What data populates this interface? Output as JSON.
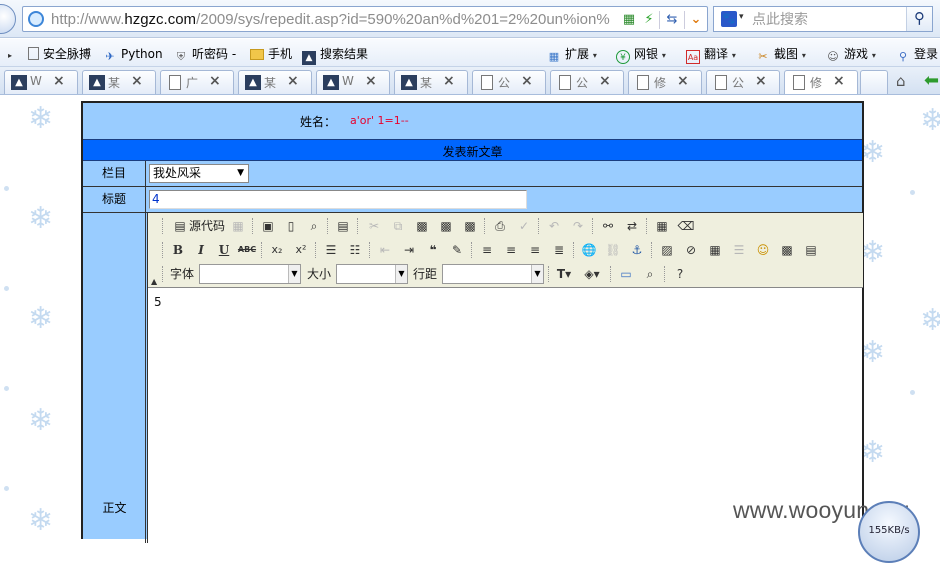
{
  "browser": {
    "url_prefix": "http://www.",
    "url_domain": "hzgzc.com",
    "url_rest": "/2009/sys/repedit.asp?id=590%20an%d%201=2%20un%ion%",
    "search_placeholder": "点此搜索"
  },
  "favorites": [
    {
      "label": "安全脉搏",
      "icon": "page-icon"
    },
    {
      "label": "Python",
      "icon": "python-icon"
    },
    {
      "label": "听密码 -",
      "icon": "shield-icon"
    },
    {
      "label": "手机",
      "icon": "folder-icon"
    },
    {
      "label": "搜索结果",
      "icon": "image-icon"
    }
  ],
  "extensions": [
    {
      "label": "扩展",
      "icon": "grid-icon"
    },
    {
      "label": "网银",
      "icon": "yen-icon"
    },
    {
      "label": "翻译",
      "icon": "translate-icon"
    },
    {
      "label": "截图",
      "icon": "scissors-icon"
    },
    {
      "label": "游戏",
      "icon": "gamepad-icon"
    },
    {
      "label": "登录",
      "icon": "key-icon"
    }
  ],
  "tabs": [
    {
      "label": "W",
      "icon": "img",
      "active": false
    },
    {
      "label": "某",
      "icon": "img",
      "active": false
    },
    {
      "label": "广",
      "icon": "doc",
      "active": false
    },
    {
      "label": "某",
      "icon": "img",
      "active": false
    },
    {
      "label": "W",
      "icon": "img",
      "active": false
    },
    {
      "label": "某",
      "icon": "img",
      "active": false
    },
    {
      "label": "公",
      "icon": "doc",
      "active": false
    },
    {
      "label": "公",
      "icon": "doc",
      "active": false
    },
    {
      "label": "修",
      "icon": "doc",
      "active": false
    },
    {
      "label": "公",
      "icon": "doc",
      "active": false
    },
    {
      "label": "修",
      "icon": "doc",
      "active": true
    }
  ],
  "form": {
    "name_label": "姓名：",
    "name_value": "a'or' 1=1--",
    "header_title": "发表新文章",
    "column_label": "栏目",
    "column_value": "我处风采",
    "title_label": "标题",
    "title_value": "4",
    "body_label": "正文",
    "body_content": "5"
  },
  "editor": {
    "source_label": "源代码",
    "font_label": "字体",
    "size_label": "大小",
    "line_spacing_label": "行距"
  },
  "watermark": "www.wooyun.org",
  "speed_text": "155KB/s"
}
